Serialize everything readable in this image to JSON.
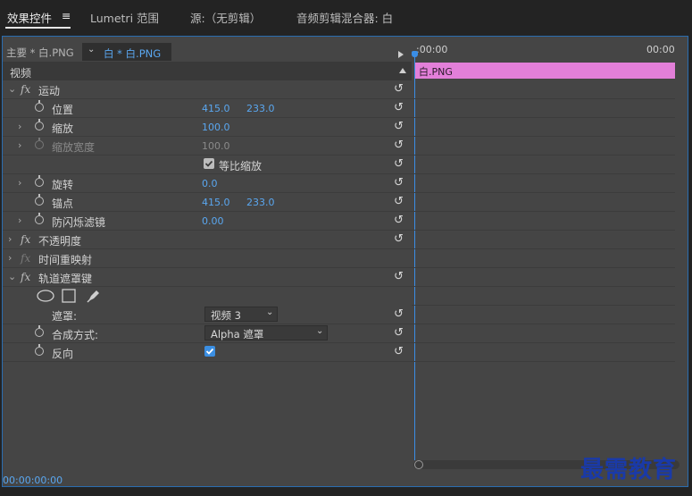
{
  "tabs": [
    {
      "label": "效果控件",
      "menu": "≡"
    },
    {
      "label": "Lumetri 范围"
    },
    {
      "label": "源:（无剪辑）"
    },
    {
      "label": "音频剪辑混合器: 白"
    }
  ],
  "source": {
    "master": "主要 * 白.PNG",
    "clip": "白 * 白.PNG"
  },
  "section_video": "视频",
  "effects": {
    "motion": {
      "name": "运动",
      "position": {
        "label": "位置",
        "x": "415.0",
        "y": "233.0"
      },
      "scale": {
        "label": "缩放",
        "value": "100.0"
      },
      "scale_width": {
        "label": "缩放宽度",
        "value": "100.0"
      },
      "uniform_scale": {
        "label": "等比缩放",
        "checked": true
      },
      "rotation": {
        "label": "旋转",
        "value": "0.0"
      },
      "anchor": {
        "label": "锚点",
        "x": "415.0",
        "y": "233.0"
      },
      "anti_flicker": {
        "label": "防闪烁滤镜",
        "value": "0.00"
      }
    },
    "opacity": {
      "name": "不透明度"
    },
    "time_remap": {
      "name": "时间重映射"
    },
    "track_matte": {
      "name": "轨道遮罩键",
      "matte": {
        "label": "遮罩:",
        "value": "视频 3"
      },
      "composite": {
        "label": "合成方式:",
        "value": "Alpha 遮罩"
      },
      "reverse": {
        "label": "反向",
        "checked": true
      }
    }
  },
  "timeline": {
    "start": ":00:00",
    "end": "00:00",
    "clip_label": "白.PNG"
  },
  "footer": {
    "timecode": "00:00:00:00"
  },
  "watermark": "最需教育",
  "colors": {
    "accent": "#3a8ee6",
    "clip": "#e37fd9",
    "value": "#5aa7f0",
    "panel": "#454545"
  }
}
